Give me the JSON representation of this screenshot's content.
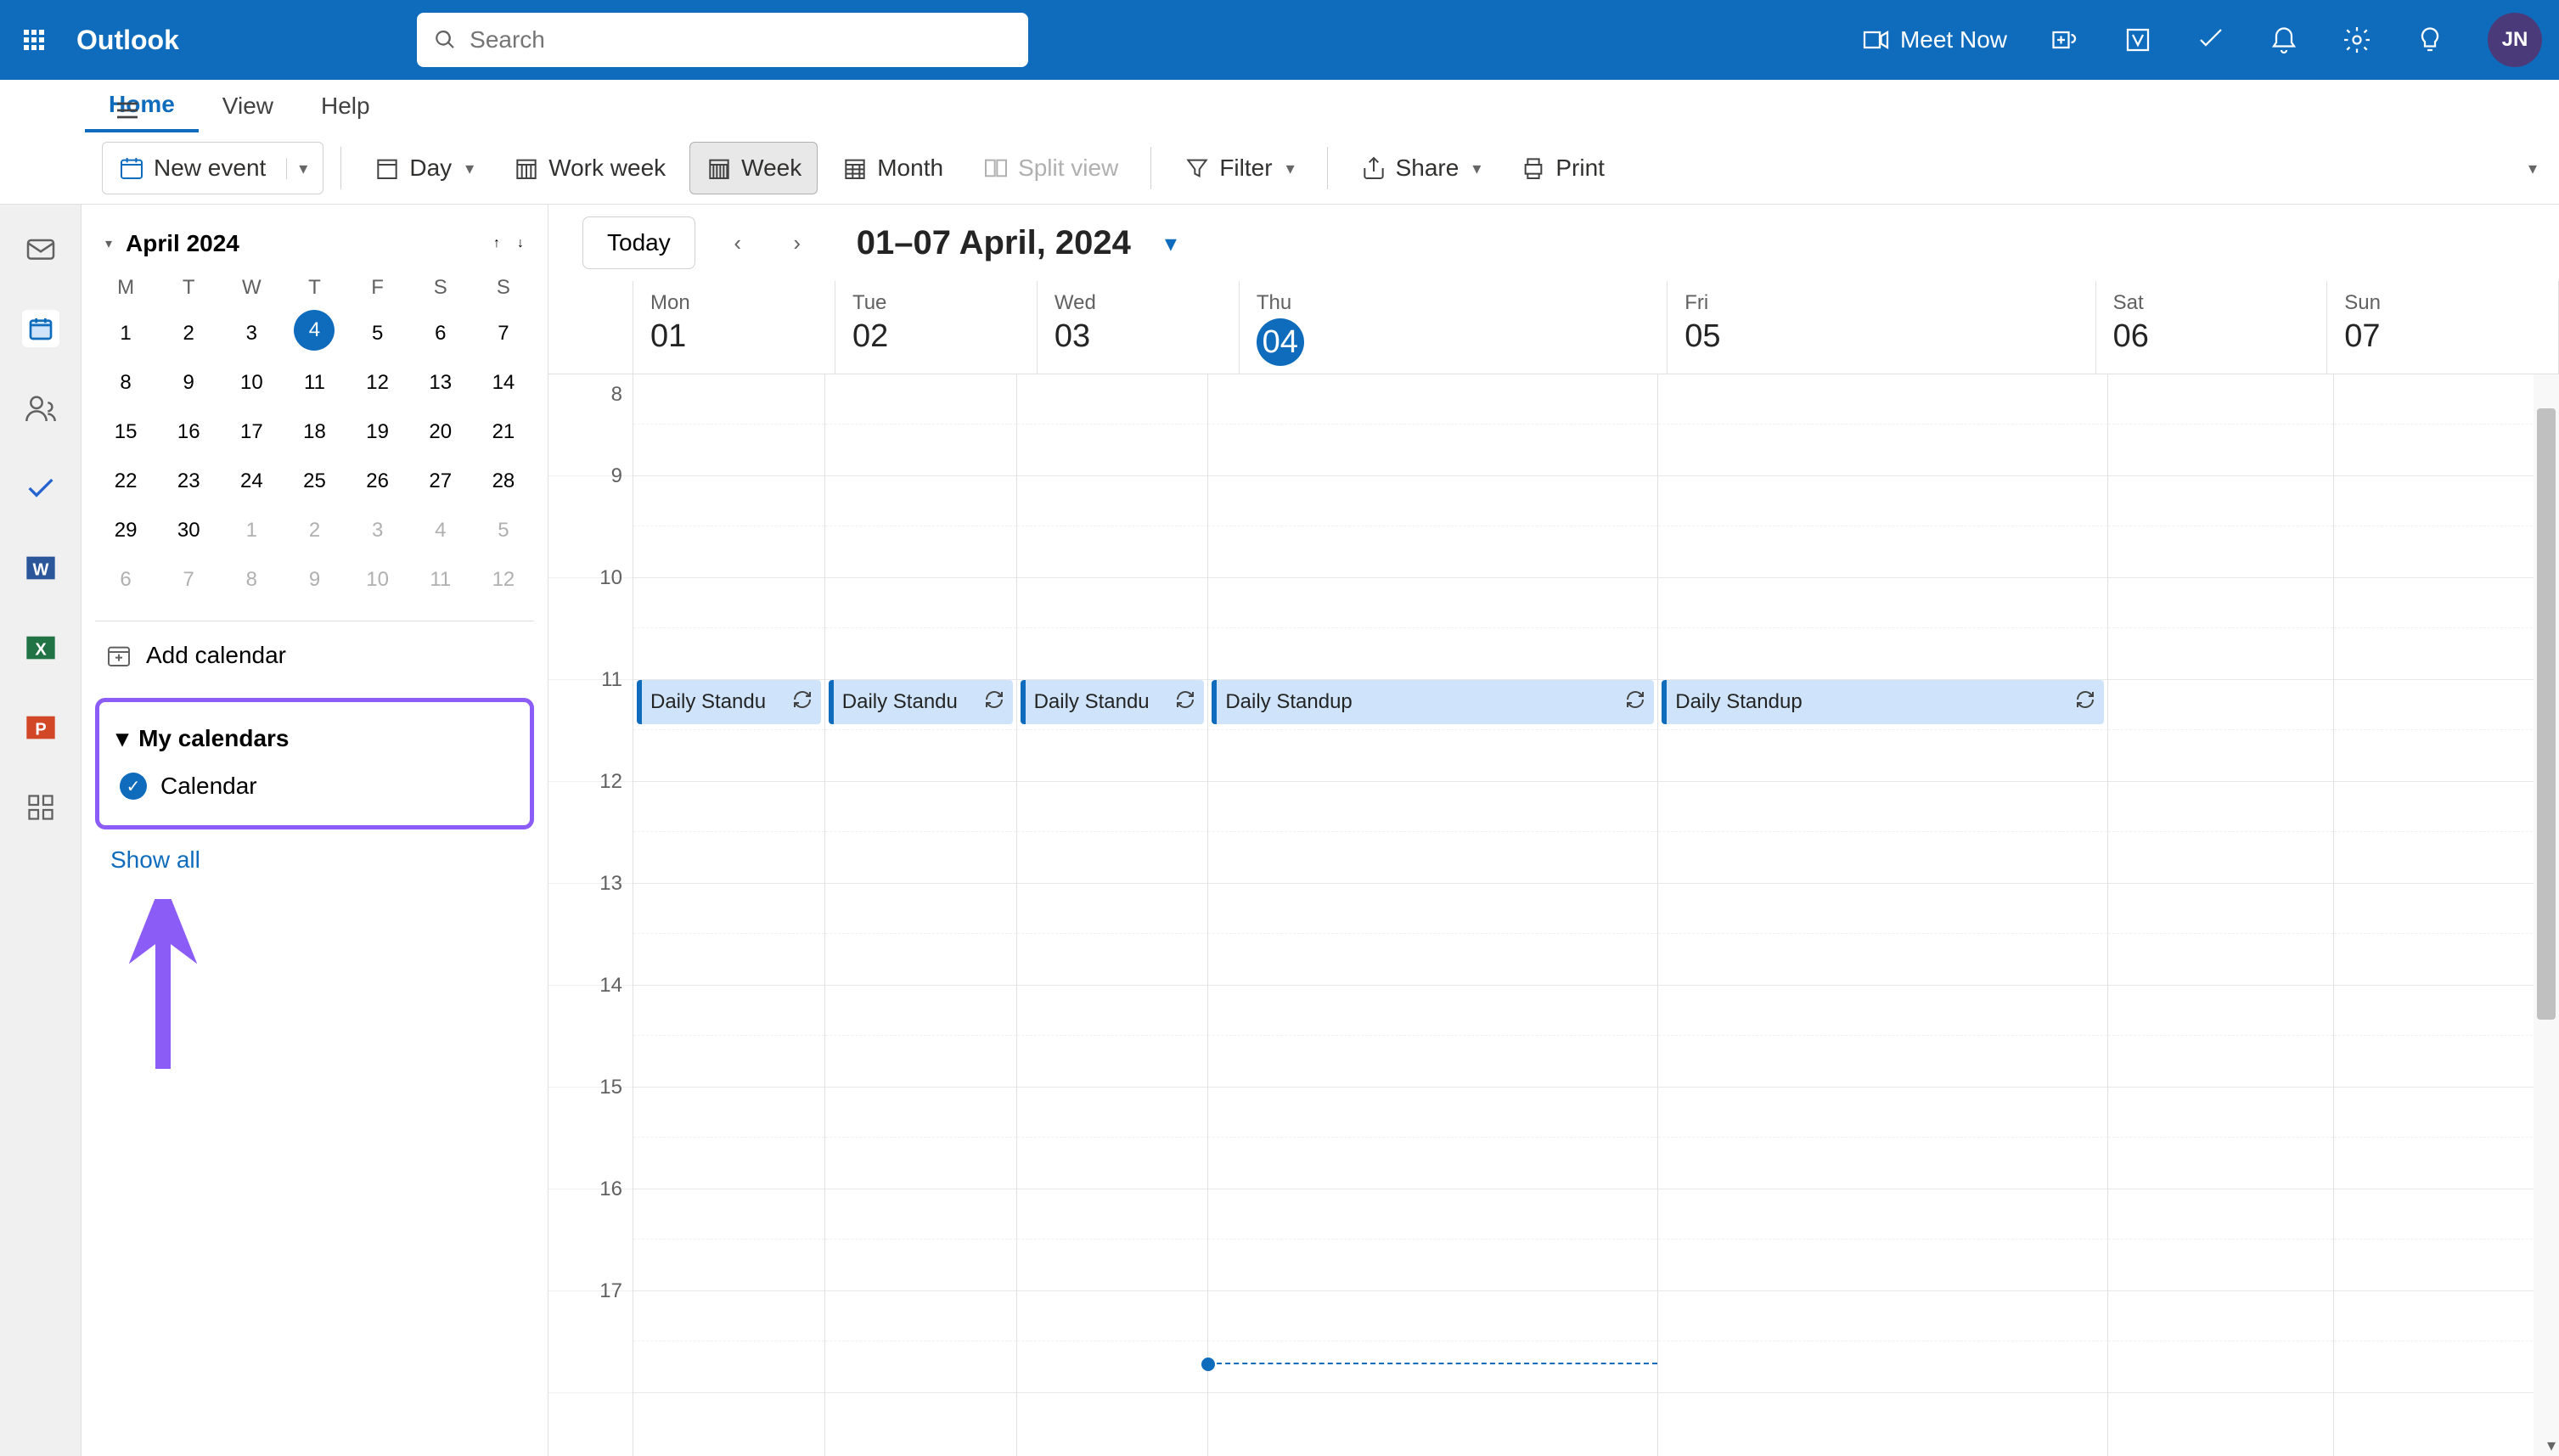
{
  "header": {
    "app_title": "Outlook",
    "search_placeholder": "Search",
    "meet_now": "Meet Now",
    "avatar_initials": "JN"
  },
  "tabs": {
    "home": "Home",
    "view": "View",
    "help": "Help"
  },
  "ribbon": {
    "new_event": "New event",
    "day": "Day",
    "work_week": "Work week",
    "week": "Week",
    "month": "Month",
    "split_view": "Split view",
    "filter": "Filter",
    "share": "Share",
    "print": "Print"
  },
  "date_nav": {
    "today": "Today",
    "range_title": "01–07 April, 2024"
  },
  "mini_cal": {
    "title": "April 2024",
    "dow": [
      "M",
      "T",
      "W",
      "T",
      "F",
      "S",
      "S"
    ],
    "weeks": [
      [
        {
          "d": "1"
        },
        {
          "d": "2"
        },
        {
          "d": "3"
        },
        {
          "d": "4",
          "today": true
        },
        {
          "d": "5"
        },
        {
          "d": "6"
        },
        {
          "d": "7"
        }
      ],
      [
        {
          "d": "8"
        },
        {
          "d": "9"
        },
        {
          "d": "10"
        },
        {
          "d": "11"
        },
        {
          "d": "12"
        },
        {
          "d": "13"
        },
        {
          "d": "14"
        }
      ],
      [
        {
          "d": "15"
        },
        {
          "d": "16"
        },
        {
          "d": "17"
        },
        {
          "d": "18"
        },
        {
          "d": "19"
        },
        {
          "d": "20"
        },
        {
          "d": "21"
        }
      ],
      [
        {
          "d": "22"
        },
        {
          "d": "23"
        },
        {
          "d": "24"
        },
        {
          "d": "25"
        },
        {
          "d": "26"
        },
        {
          "d": "27"
        },
        {
          "d": "28"
        }
      ],
      [
        {
          "d": "29"
        },
        {
          "d": "30"
        },
        {
          "d": "1",
          "other": true
        },
        {
          "d": "2",
          "other": true
        },
        {
          "d": "3",
          "other": true
        },
        {
          "d": "4",
          "other": true
        },
        {
          "d": "5",
          "other": true
        }
      ],
      [
        {
          "d": "6",
          "other": true
        },
        {
          "d": "7",
          "other": true
        },
        {
          "d": "8",
          "other": true
        },
        {
          "d": "9",
          "other": true
        },
        {
          "d": "10",
          "other": true
        },
        {
          "d": "11",
          "other": true
        },
        {
          "d": "12",
          "other": true
        }
      ]
    ]
  },
  "sidebar": {
    "add_calendar": "Add calendar",
    "my_calendars": "My calendars",
    "calendar_item": "Calendar",
    "show_all": "Show all"
  },
  "week": {
    "days": [
      {
        "dow": "Mon",
        "date": "01",
        "size": "small"
      },
      {
        "dow": "Tue",
        "date": "02",
        "size": "small"
      },
      {
        "dow": "Wed",
        "date": "03",
        "size": "small"
      },
      {
        "dow": "Thu",
        "date": "04",
        "size": "wide",
        "today": true
      },
      {
        "dow": "Fri",
        "date": "05",
        "size": "wide"
      },
      {
        "dow": "Sat",
        "date": "06",
        "size": "normal"
      },
      {
        "dow": "Sun",
        "date": "07",
        "size": "normal"
      }
    ],
    "hours": [
      "8",
      "9",
      "10",
      "11",
      "12",
      "13",
      "14",
      "15",
      "16",
      "17"
    ],
    "events": [
      {
        "day": 0,
        "hour": 11,
        "title": "Daily Standu"
      },
      {
        "day": 1,
        "hour": 11,
        "title": "Daily Standu"
      },
      {
        "day": 2,
        "hour": 11,
        "title": "Daily Standu"
      },
      {
        "day": 3,
        "hour": 11,
        "title": "Daily Standup"
      },
      {
        "day": 4,
        "hour": 11,
        "title": "Daily Standup"
      }
    ]
  },
  "colors": {
    "brand": "#0F6CBD",
    "highlight": "#8B5CF6"
  }
}
